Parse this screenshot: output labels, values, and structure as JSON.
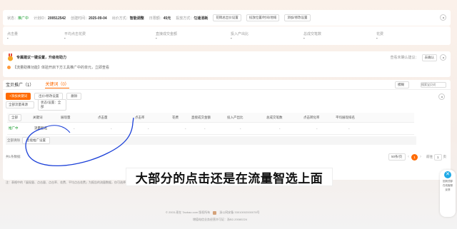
{
  "header": {
    "status_label": "状态：",
    "status_value": "推广中",
    "plan_id_label": "计划ID：",
    "plan_id": "200512542",
    "created_label": "创建时间：",
    "created": "2025-09-04",
    "bid_label": "出价方式：",
    "bid": "智能调整",
    "budget_label": "日限额：",
    "budget": "45元",
    "delivery_label": "投放方式：",
    "delivery": "匀速消耗",
    "targeting_btn": "花销总出价设置",
    "edit_time_btn": "投放位置/时间/地域",
    "custom_btn": "添加/修改设置"
  },
  "metrics": [
    {
      "label": "点击量",
      "value": "-"
    },
    {
      "label": "平均点击花费",
      "value": "-"
    },
    {
      "label": "直接成交金额",
      "value": "-"
    },
    {
      "label": "投入产出比",
      "value": "-"
    },
    {
      "label": "总成交笔数",
      "value": "-"
    },
    {
      "label": "花费",
      "value": "-"
    }
  ],
  "suggest": {
    "title": "专属建议一键设置，升级有助力",
    "right_label": "查看未确认建议：",
    "right_link": "去确认",
    "notice": "【流量助推功能】体验开启下方工具推广中的单元，立即查看"
  },
  "tabs": {
    "items": [
      "宝贝推广（1）",
      "关键词（0）"
    ],
    "search_select": "模糊",
    "search_placeholder": "搜索宝贝词"
  },
  "toolbar": {
    "add_keyword": "+添加关键词",
    "edit_bid": "出价/修改设置",
    "delete": "删除",
    "filter_source": "全部流量来源",
    "filter_status": "状态/设置：全部"
  },
  "table": {
    "headers": [
      "全部",
      "关键词",
      "展现量",
      "点击量",
      "点击率",
      "花费",
      "直接成交金额",
      "投入产出比",
      "总成交笔数",
      "点击转化率",
      "平均展现排名"
    ],
    "rows": [
      {
        "status": "推广中",
        "keyword": "流量智选",
        "cells": [
          "-",
          "-",
          "-",
          "-",
          "-",
          "-",
          "-",
          "-",
          "-"
        ]
      }
    ],
    "sub_buttons": [
      "全部清除",
      "智能推广设置"
    ]
  },
  "pagination": {
    "total": "共1条数据",
    "page_size": "50条/页",
    "current": "1",
    "jump_label": "前往",
    "jump_value": "1",
    "page_unit": "页"
  },
  "footer": {
    "note": "注：表格中的「展现量、点击量、点击率、花费、平均点击花费」为报告的流量数据，仅可选择不同时间段来查看。",
    "copyright": "© 2003-现在 Taobao.com 版权所有",
    "license": "浙公网安备 33010002000078号",
    "icp": "增值电信业务经营许可证：浙B2-20080224"
  },
  "subtitle": "大部分的点击还是在流量智选上面",
  "side_float": {
    "items": [
      "回到顶部",
      "在线客服",
      "反馈"
    ]
  },
  "colors": {
    "accent": "#ff6a00",
    "status_green": "#1a9e2f"
  }
}
